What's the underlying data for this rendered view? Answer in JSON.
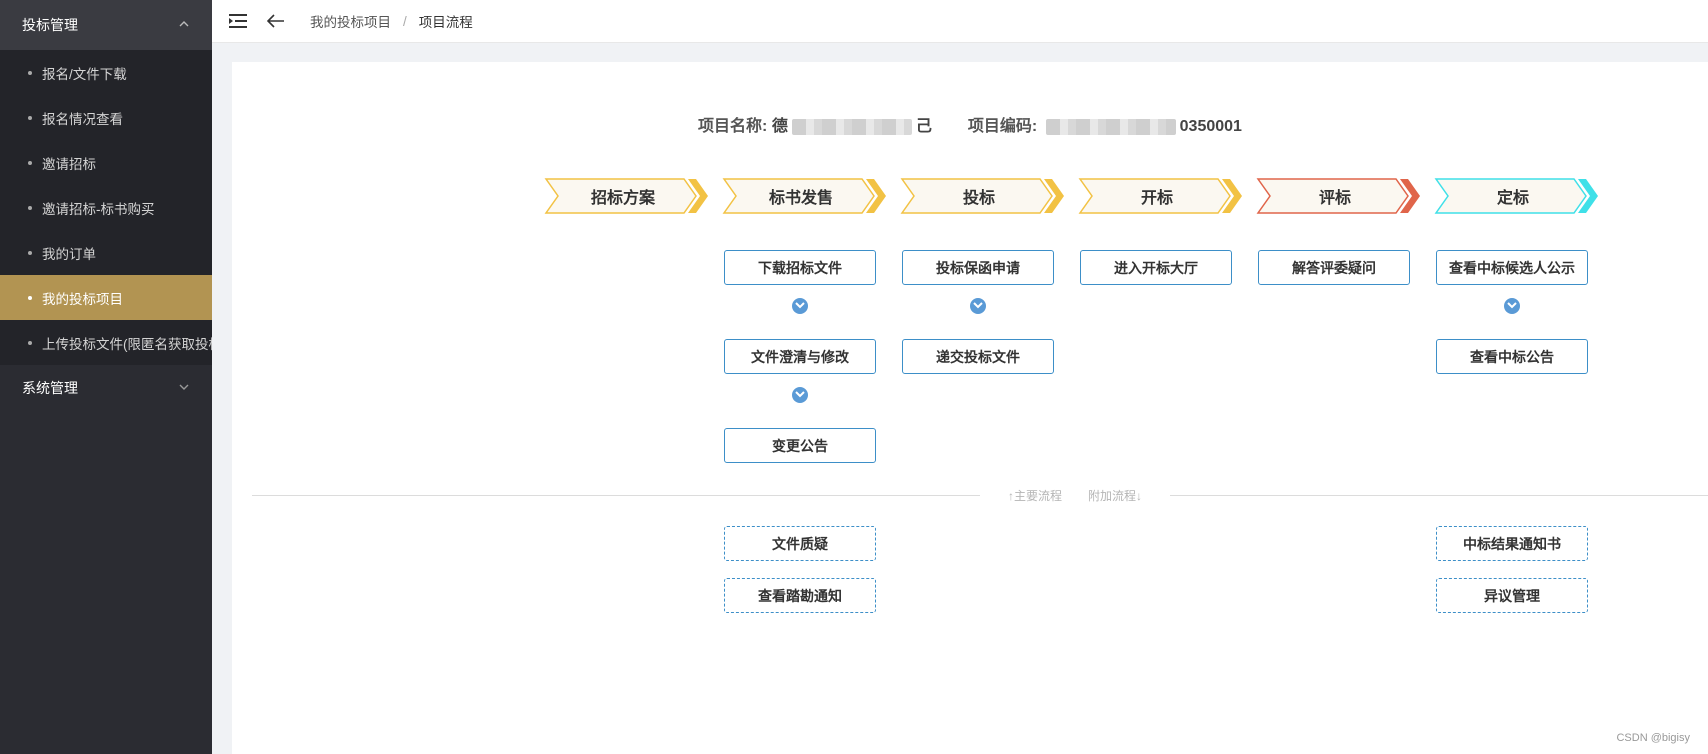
{
  "sidebar": {
    "group_title": "投标管理",
    "items": [
      {
        "label": "报名/文件下载"
      },
      {
        "label": "报名情况查看"
      },
      {
        "label": "邀请招标"
      },
      {
        "label": "邀请招标-标书购买"
      },
      {
        "label": "我的订单"
      },
      {
        "label": "我的投标项目"
      },
      {
        "label": "上传投标文件(限匿名获取投标文件)"
      }
    ],
    "active_index": 5,
    "system_title": "系统管理"
  },
  "breadcrumb": {
    "parent": "我的投标项目",
    "separator": "/",
    "current": "项目流程"
  },
  "project": {
    "name_label": "项目名称:",
    "name_prefix": "德",
    "name_suffix": "己",
    "code_label": "项目编码:",
    "code_suffix": "0350001"
  },
  "steps": [
    {
      "label": "招标方案",
      "color": "#f2c244"
    },
    {
      "label": "标书发售",
      "color": "#f2c244"
    },
    {
      "label": "投标",
      "color": "#f2c244"
    },
    {
      "label": "开标",
      "color": "#f2c244"
    },
    {
      "label": "评标",
      "color": "#e0654a"
    },
    {
      "label": "定标",
      "color": "#3fe0e8"
    }
  ],
  "actions": {
    "download_doc": "下载招标文件",
    "clarify": "文件澄清与修改",
    "change_notice": "变更公告",
    "guarantee": "投标保函申请",
    "submit_bid": "递交投标文件",
    "enter_hall": "进入开标大厅",
    "answer_question": "解答评委疑问",
    "candidate_notice": "查看中标候选人公示",
    "award_notice": "查看中标公告"
  },
  "divider": {
    "main": "↑主要流程",
    "extra": "附加流程↓"
  },
  "extra_actions": {
    "doc_question": "文件质疑",
    "site_visit": "查看踏勘通知",
    "result_letter": "中标结果通知书",
    "objection": "异议管理"
  },
  "watermark": "CSDN @bigisy"
}
